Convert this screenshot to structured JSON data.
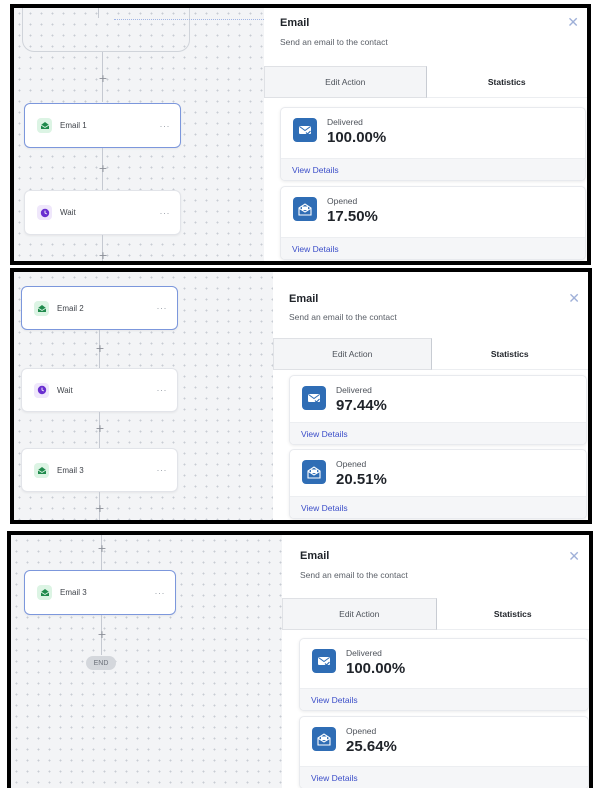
{
  "frames": [
    {
      "panel": {
        "title": "Email",
        "subtitle": "Send an email to the contact",
        "close": "✕"
      },
      "tabs": {
        "edit": "Edit Action",
        "stats": "Statistics"
      },
      "nodes": [
        {
          "label": "Email 1",
          "type": "email",
          "menu": "···"
        },
        {
          "label": "Wait",
          "type": "wait",
          "menu": "···"
        }
      ],
      "stats": [
        {
          "label": "Delivered",
          "value": "100.00%",
          "link": "View Details"
        },
        {
          "label": "Opened",
          "value": "17.50%",
          "link": "View Details"
        }
      ]
    },
    {
      "panel": {
        "title": "Email",
        "subtitle": "Send an email to the contact",
        "close": "✕"
      },
      "tabs": {
        "edit": "Edit Action",
        "stats": "Statistics"
      },
      "nodes": [
        {
          "label": "Email 2",
          "type": "email",
          "menu": "···"
        },
        {
          "label": "Wait",
          "type": "wait",
          "menu": "···"
        },
        {
          "label": "Email 3",
          "type": "email",
          "menu": "···"
        }
      ],
      "stats": [
        {
          "label": "Delivered",
          "value": "97.44%",
          "link": "View Details"
        },
        {
          "label": "Opened",
          "value": "20.51%",
          "link": "View Details"
        }
      ]
    },
    {
      "panel": {
        "title": "Email",
        "subtitle": "Send an email to the contact",
        "close": "✕"
      },
      "tabs": {
        "edit": "Edit Action",
        "stats": "Statistics"
      },
      "nodes": [
        {
          "label": "Email 3",
          "type": "email",
          "menu": "···"
        }
      ],
      "end_label": "END",
      "stats": [
        {
          "label": "Delivered",
          "value": "100.00%",
          "link": "View Details"
        },
        {
          "label": "Opened",
          "value": "25.64%",
          "link": "View Details"
        }
      ]
    }
  ],
  "plus_symbol": "+",
  "icons": {
    "email": "envelope-open-icon",
    "wait": "clock-icon",
    "delivered": "delivered-envelope-icon",
    "opened": "opened-envelope-icon"
  },
  "colors": {
    "email_icon_bg": "#dcf4e4",
    "email_icon_fg": "#1f8a4c",
    "wait_icon_bg": "#efe7fb",
    "wait_icon_fg": "#6a2fd0",
    "stat_icon_bg": "#2f6db5",
    "link": "#3b4ec9",
    "selected_border": "#7c97dc"
  }
}
